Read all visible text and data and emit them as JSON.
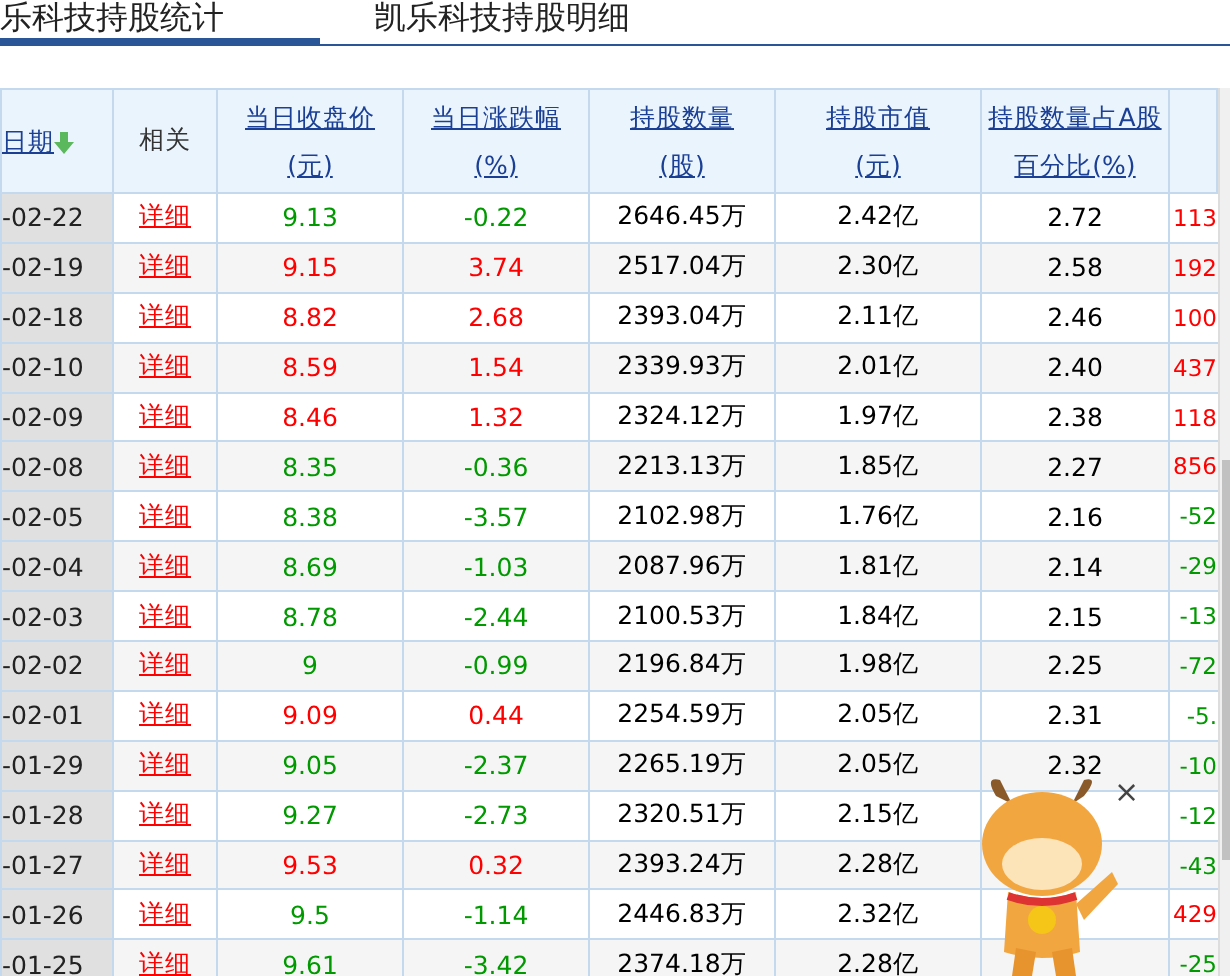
{
  "tabs": [
    {
      "label": "乐科技持股统计",
      "selected": true
    },
    {
      "label": "凯乐科技持股明细",
      "selected": false
    }
  ],
  "table": {
    "columns": [
      {
        "label": "日期",
        "sorted": true
      },
      {
        "label": "相关"
      },
      {
        "label": "当日收盘价",
        "unit": "(元)"
      },
      {
        "label": "当日涨跌幅",
        "unit": "(%)"
      },
      {
        "label": "持股数量",
        "unit": "(股)"
      },
      {
        "label": "持股市值",
        "unit": "(元)"
      },
      {
        "label": "持股数量占A股",
        "unit": "百分比(%)"
      }
    ],
    "rows": [
      {
        "date": "-02-22",
        "link": "详细",
        "price": "9.13",
        "change": "-0.22",
        "color": "#009900",
        "shares": "2646.45万",
        "value": "2.42亿",
        "pct": "2.72",
        "column_8": {
          "text": "113",
          "color": "#ff0000"
        }
      },
      {
        "date": "-02-19",
        "link": "详细",
        "price": "9.15",
        "change": "3.74",
        "color": "#ff0000",
        "shares": "2517.04万",
        "value": "2.30亿",
        "pct": "2.58",
        "column_8": {
          "text": "192",
          "color": "#ff0000"
        }
      },
      {
        "date": "-02-18",
        "link": "详细",
        "price": "8.82",
        "change": "2.68",
        "color": "#ff0000",
        "shares": "2393.04万",
        "value": "2.11亿",
        "pct": "2.46",
        "column_8": {
          "text": "100",
          "color": "#ff0000"
        }
      },
      {
        "date": "-02-10",
        "link": "详细",
        "price": "8.59",
        "change": "1.54",
        "color": "#ff0000",
        "shares": "2339.93万",
        "value": "2.01亿",
        "pct": "2.40",
        "column_8": {
          "text": "437",
          "color": "#ff0000"
        }
      },
      {
        "date": "-02-09",
        "link": "详细",
        "price": "8.46",
        "change": "1.32",
        "color": "#ff0000",
        "shares": "2324.12万",
        "value": "1.97亿",
        "pct": "2.38",
        "column_8": {
          "text": "118",
          "color": "#ff0000"
        }
      },
      {
        "date": "-02-08",
        "link": "详细",
        "price": "8.35",
        "change": "-0.36",
        "color": "#009900",
        "shares": "2213.13万",
        "value": "1.85亿",
        "pct": "2.27",
        "column_8": {
          "text": "856",
          "color": "#ff0000"
        }
      },
      {
        "date": "-02-05",
        "link": "详细",
        "price": "8.38",
        "change": "-3.57",
        "color": "#009900",
        "shares": "2102.98万",
        "value": "1.76亿",
        "pct": "2.16",
        "column_8": {
          "text": "-52",
          "color": "#009900"
        }
      },
      {
        "date": "-02-04",
        "link": "详细",
        "price": "8.69",
        "change": "-1.03",
        "color": "#009900",
        "shares": "2087.96万",
        "value": "1.81亿",
        "pct": "2.14",
        "column_8": {
          "text": "-29",
          "color": "#009900"
        }
      },
      {
        "date": "-02-03",
        "link": "详细",
        "price": "8.78",
        "change": "-2.44",
        "color": "#009900",
        "shares": "2100.53万",
        "value": "1.84亿",
        "pct": "2.15",
        "column_8": {
          "text": "-13",
          "color": "#009900"
        }
      },
      {
        "date": "-02-02",
        "link": "详细",
        "price": "9",
        "change": "-0.99",
        "color": "#009900",
        "shares": "2196.84万",
        "value": "1.98亿",
        "pct": "2.25",
        "column_8": {
          "text": "-72",
          "color": "#009900"
        }
      },
      {
        "date": "-02-01",
        "link": "详细",
        "price": "9.09",
        "change": "0.44",
        "color": "#ff0000",
        "shares": "2254.59万",
        "value": "2.05亿",
        "pct": "2.31",
        "column_8": {
          "text": "-5.",
          "color": "#009900"
        }
      },
      {
        "date": "-01-29",
        "link": "详细",
        "price": "9.05",
        "change": "-2.37",
        "color": "#009900",
        "shares": "2265.19万",
        "value": "2.05亿",
        "pct": "2.32",
        "column_8": {
          "text": "-10",
          "color": "#009900"
        }
      },
      {
        "date": "-01-28",
        "link": "详细",
        "price": "9.27",
        "change": "-2.73",
        "color": "#009900",
        "shares": "2320.51万",
        "value": "2.15亿",
        "column_8": {
          "text": "-12",
          "color": "#009900"
        }
      },
      {
        "date": "-01-27",
        "link": "详细",
        "price": "9.53",
        "change": "0.32",
        "color": "#ff0000",
        "shares": "2393.24万",
        "value": "2.28亿",
        "column_8": {
          "text": "-43",
          "color": "#009900"
        }
      },
      {
        "date": "-01-26",
        "link": "详细",
        "price": "9.5",
        "change": "-1.14",
        "color": "#009900",
        "shares": "2446.83万",
        "value": "2.32亿",
        "column_8": {
          "text": "429",
          "color": "#ff0000"
        }
      },
      {
        "date": "-01-25",
        "link": "详细",
        "price": "9.61",
        "change": "-3.42",
        "color": "#009900",
        "shares": "2374.18万",
        "value": "2.28亿",
        "column_8": {
          "text": "-25",
          "color": "#009900"
        }
      }
    ]
  },
  "popup": {
    "kind": "mascot",
    "close": "×"
  }
}
